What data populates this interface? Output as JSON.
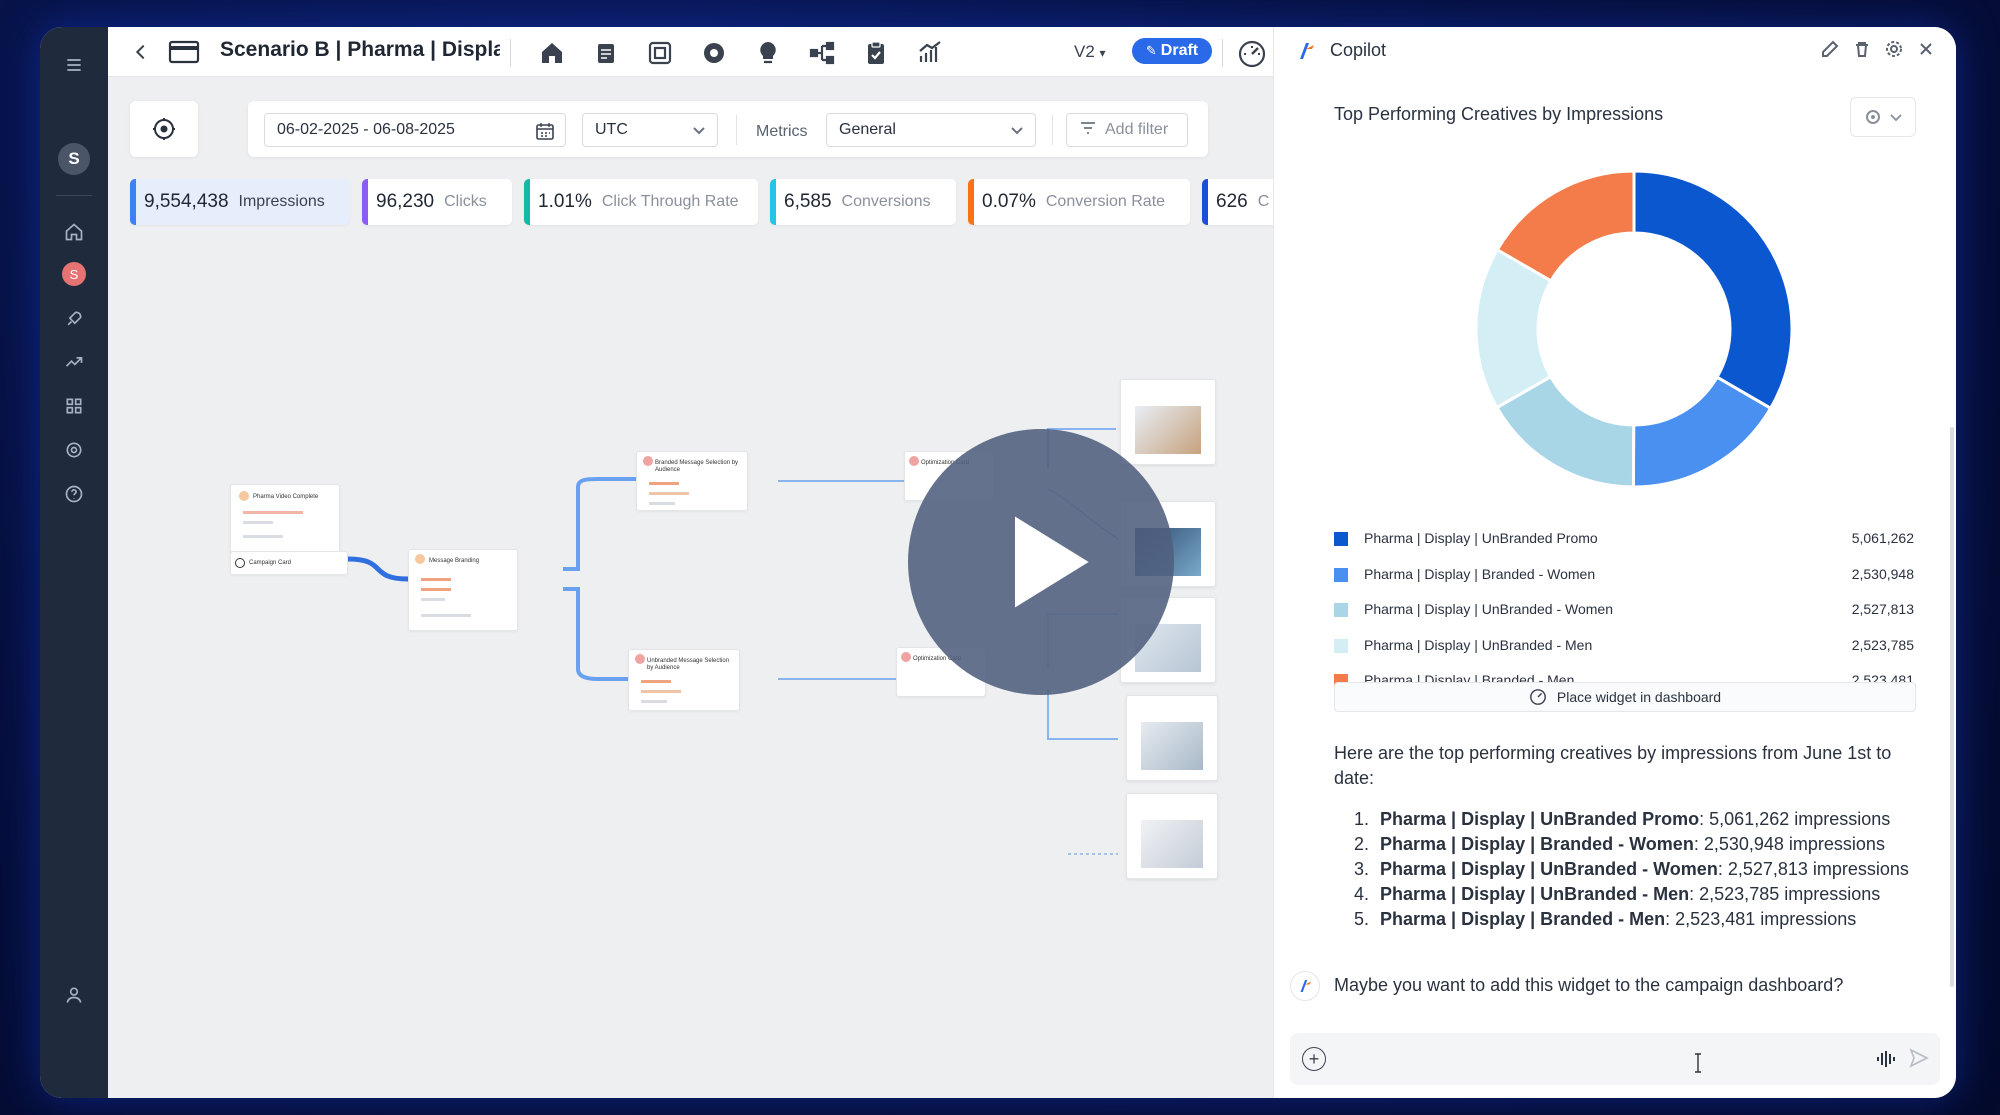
{
  "topbar": {
    "title": "Scenario B | Pharma | Display",
    "version": "V2",
    "draft_label": "Draft"
  },
  "filters": {
    "date_range": "06-02-2025 - 06-08-2025",
    "timezone": "UTC",
    "metrics_label": "Metrics",
    "metrics_value": "General",
    "add_filter_label": "Add filter"
  },
  "kpis": [
    {
      "value": "9,554,438",
      "label": "Impressions",
      "color": "#3b82f6"
    },
    {
      "value": "96,230",
      "label": "Clicks",
      "color": "#8b5cf6"
    },
    {
      "value": "1.01%",
      "label": "Click Through Rate",
      "color": "#14b8a6"
    },
    {
      "value": "6,585",
      "label": "Conversions",
      "color": "#22c5e8"
    },
    {
      "value": "0.07%",
      "label": "Conversion Rate",
      "color": "#f97316"
    },
    {
      "value": "626",
      "label": "C",
      "color": "#1d4ed8"
    }
  ],
  "canvas": {
    "nodes": {
      "video": "Pharma Video Complete",
      "campaign": "Campaign Card",
      "branding": "Message Branding",
      "branded": "Branded Message Selection by Audience",
      "unbranded": "Unbranded Message Selection by Audience",
      "opt1": "Optimization Card",
      "opt2": "Optimization Card"
    }
  },
  "copilot": {
    "title": "Copilot",
    "widget_title": "Top Performing Creatives by Impressions",
    "place_widget_label": "Place widget in dashboard",
    "intro": "Here are the top performing creatives by impressions from June 1st to date:",
    "list": [
      {
        "num": "1.",
        "name": "Pharma | Display | UnBranded Promo",
        "rest": ": 5,061,262 impressions"
      },
      {
        "num": "2.",
        "name": "Pharma | Display | Branded - Women",
        "rest": ": 2,530,948 impressions"
      },
      {
        "num": "3.",
        "name": "Pharma | Display | UnBranded - Women",
        "rest": ": 2,527,813 impressions"
      },
      {
        "num": "4.",
        "name": "Pharma | Display | UnBranded - Men",
        "rest": ": 2,523,785 impressions"
      },
      {
        "num": "5.",
        "name": "Pharma | Display | Branded - Men",
        "rest": ": 2,523,481 impressions"
      }
    ],
    "question": "Maybe you want to add this widget to the campaign dashboard?"
  },
  "chart_data": {
    "type": "pie",
    "categories": [
      "Pharma | Display | UnBranded Promo",
      "Pharma | Display | Branded - Women",
      "Pharma | Display | UnBranded - Women",
      "Pharma | Display | UnBranded - Men",
      "Pharma | Display | Branded - Men"
    ],
    "values": [
      5061262,
      2530948,
      2527813,
      2523785,
      2523481
    ],
    "labels": [
      "5,061,262",
      "2,530,948",
      "2,527,813",
      "2,523,785",
      "2,523,481"
    ],
    "colors": [
      "#0b57d0",
      "#4a90f0",
      "#a8d6e6",
      "#d4eef6",
      "#f47c4a"
    ],
    "title": "Top Performing Creatives by Impressions",
    "legend": "bottom"
  }
}
